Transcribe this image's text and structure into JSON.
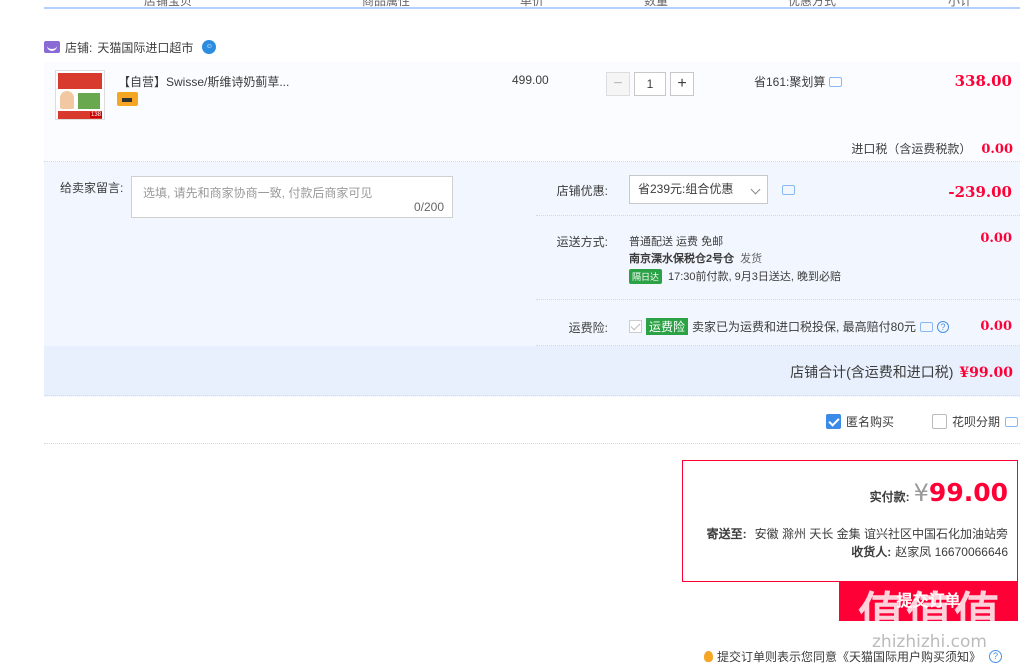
{
  "header": {
    "columns": [
      "店铺宝贝",
      "商品属性",
      "单价",
      "数量",
      "优惠方式",
      "小计"
    ]
  },
  "shop": {
    "label": "店铺:",
    "name": "天猫国际进口超市"
  },
  "item": {
    "title": "【自营】Swisse/斯维诗奶蓟草...",
    "thumb_price": "138",
    "unit_price": "499.00",
    "quantity": "1",
    "qty_minus": "−",
    "qty_plus": "+",
    "promo": "省161:聚划算",
    "subtotal": "338.00"
  },
  "import_tax": {
    "label": "进口税（含运费税款）",
    "value": "0.00"
  },
  "message": {
    "label": "给卖家留言:",
    "placeholder": "选填, 请先和商家协商一致, 付款后商家可见",
    "count": "0/200"
  },
  "shop_discount": {
    "label": "店铺优惠:",
    "selected": "省239元:组合优惠",
    "amount": "-239.00"
  },
  "shipping": {
    "label": "运送方式:",
    "line1": "普通配送 运费 免邮",
    "warehouse": "南京溧水保税仓2号仓",
    "dispatch": "发货",
    "badge": "隔日达",
    "eta": "17:30前付款, 9月3日送达, 晚到必赔",
    "amount": "0.00"
  },
  "insurance": {
    "label": "运费险:",
    "tag": "运费险",
    "desc": "卖家已为运费和进口税投保, 最高赔付80元",
    "help": "?",
    "amount": "0.00"
  },
  "shop_total": {
    "label": "店铺合计(含运费和进口税)",
    "value": "¥99.00"
  },
  "options": {
    "anonymous": "匿名购买",
    "huabei": "花呗分期"
  },
  "payment": {
    "label": "实付款:",
    "currency": "¥",
    "amount": "99.00",
    "address_label": "寄送至:",
    "address": "安徽 滁州 天长 金集 谊兴社区中国石化加油站旁",
    "receiver_label": "收货人:",
    "receiver": "赵家凤 16670066646",
    "submit": "提交订单"
  },
  "watermark": {
    "text": "值值值",
    "url": "zhizhizhi.com"
  },
  "agreement": {
    "text": "提交订单则表示您同意《天猫国际用户购买须知》",
    "help": "?"
  },
  "colors": {
    "accent_red": "#ff0036",
    "blue": "#3b8ae8",
    "green_badge": "#2ba245"
  }
}
